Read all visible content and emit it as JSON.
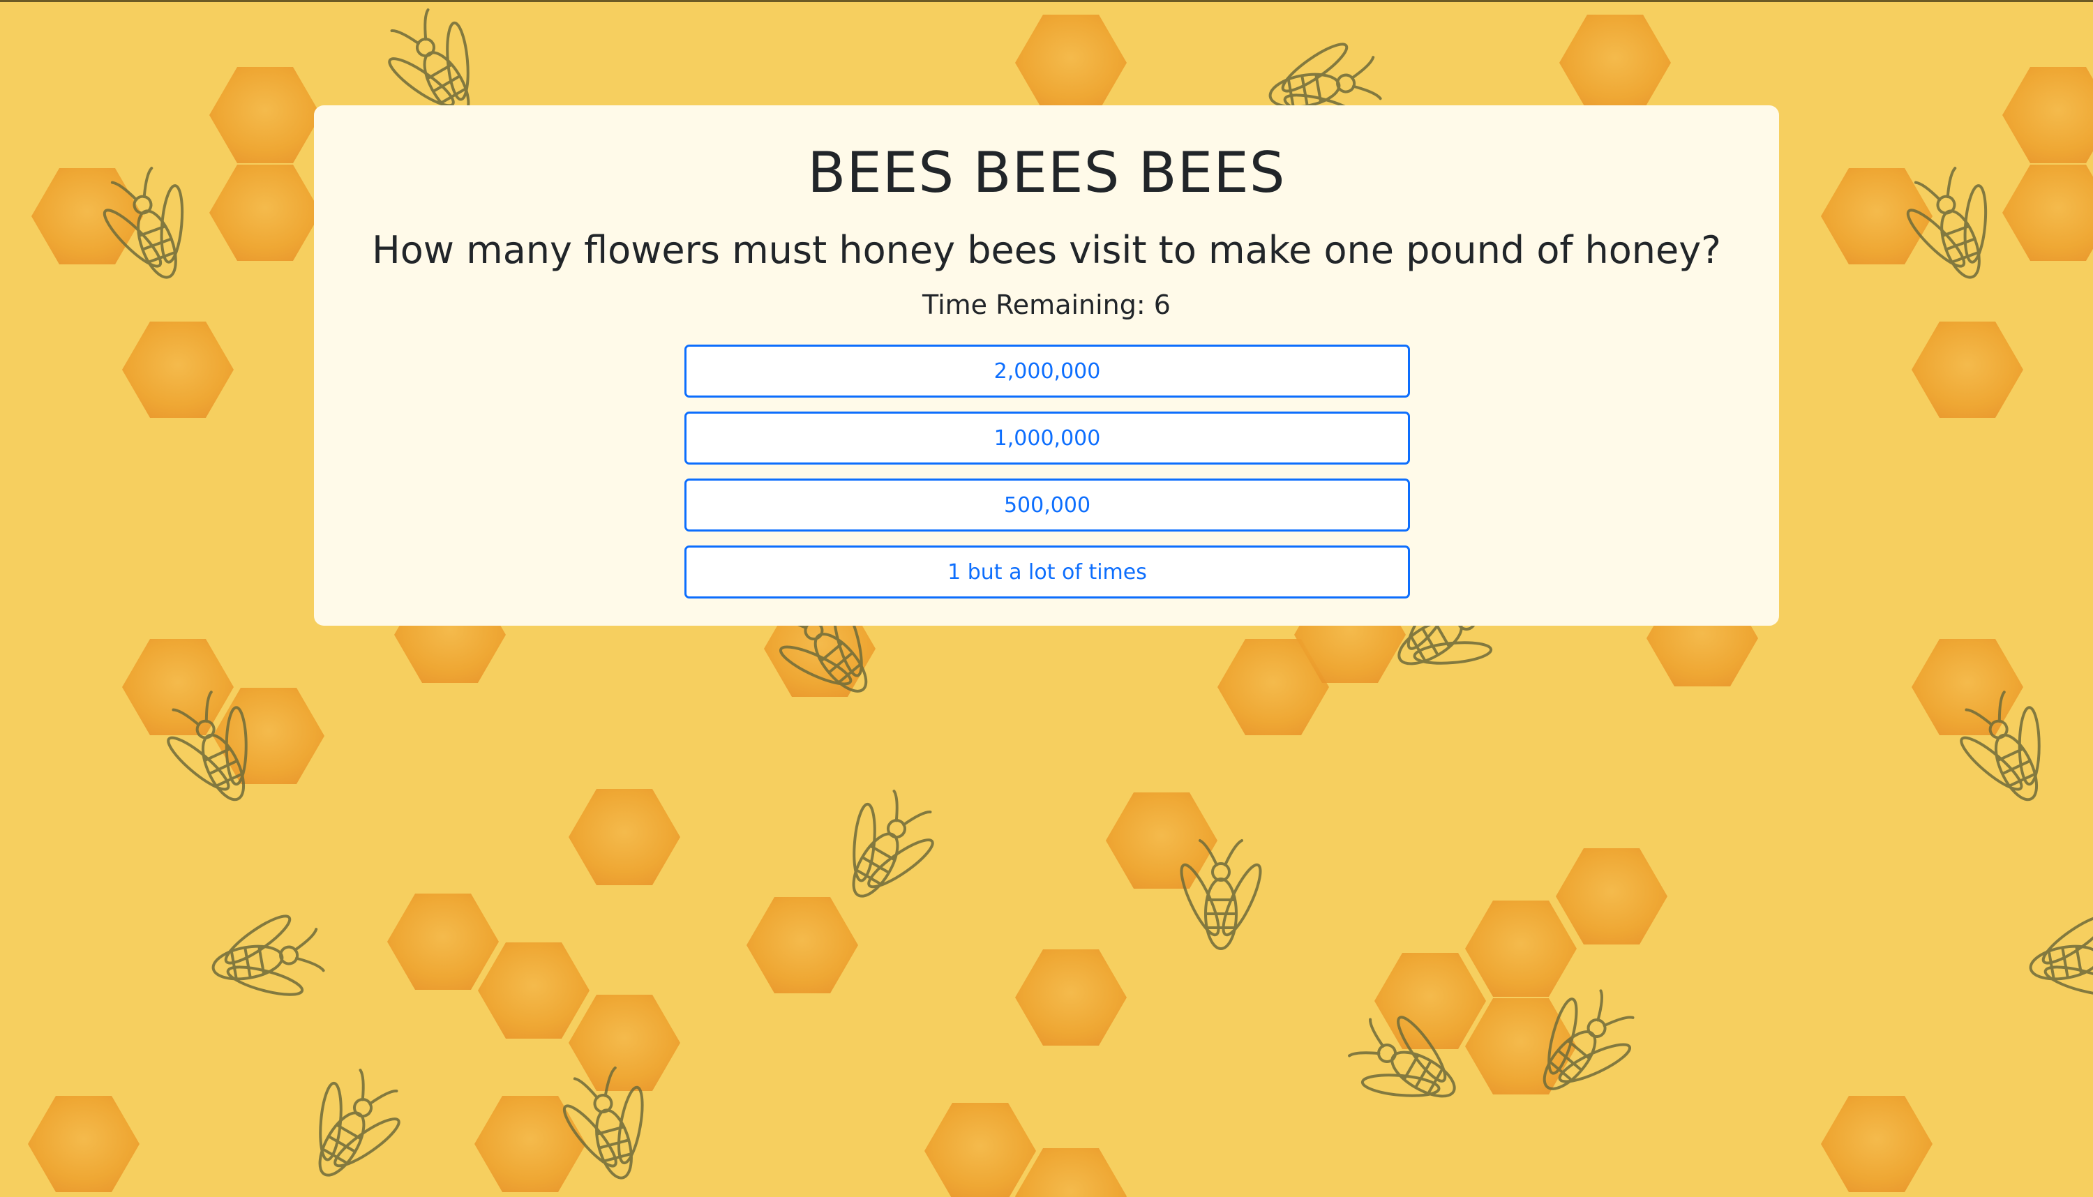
{
  "page": {
    "title": "BEES BEES BEES"
  },
  "quiz": {
    "question": "How many flowers must honey bees visit to make one pound of honey?",
    "timer_label": "Time Remaining: 6",
    "answers": [
      {
        "label": "2,000,000"
      },
      {
        "label": "1,000,000"
      },
      {
        "label": "500,000"
      },
      {
        "label": "1 but a lot of times"
      }
    ]
  },
  "colors": {
    "background": "#f6cf5f",
    "card": "#fffae9",
    "accent": "#0d6efd",
    "honeycomb": "#f0a330",
    "bee_sketch": "#6e6b3a"
  },
  "icons": {
    "background_art": "bees-and-honeycomb-pattern"
  }
}
